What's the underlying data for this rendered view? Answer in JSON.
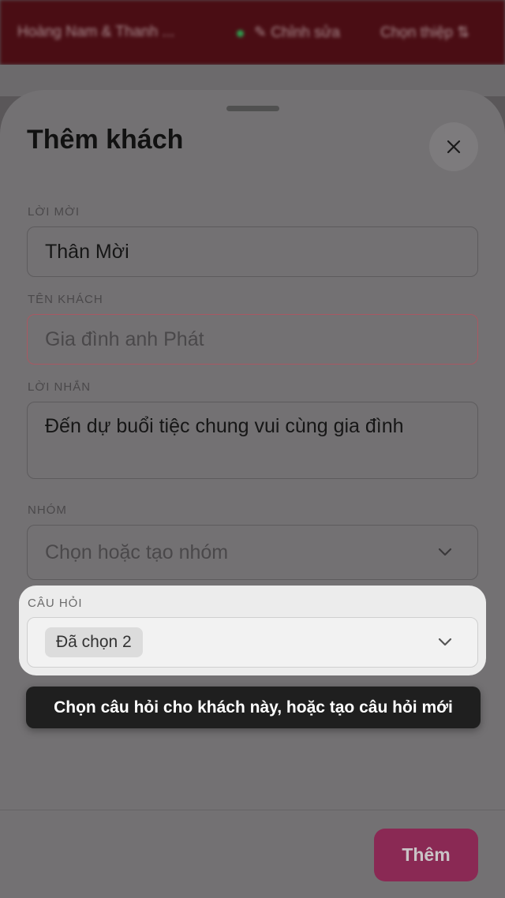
{
  "background": {
    "title": "Hoàng Nam & Thanh ...",
    "edit_label": "✎ Chỉnh sửa",
    "action_label": "Chọn thiệp ⇅"
  },
  "sheet": {
    "title": "Thêm khách",
    "close_icon": "close-icon",
    "invitation": {
      "label": "LỜI MỜI",
      "value": "Thân Mời"
    },
    "guest_name": {
      "label": "TÊN KHÁCH",
      "placeholder": "Gia đình anh Phát"
    },
    "message": {
      "label": "LỜI NHẮN",
      "value": "Đến dự buổi tiệc chung vui cùng gia đình"
    },
    "group": {
      "label": "NHÓM",
      "placeholder": "Chọn hoặc tạo nhóm"
    },
    "questions": {
      "label": "CÂU HỎI",
      "selected_chip": "Đã chọn 2"
    },
    "submit_label": "Thêm"
  },
  "tooltip": {
    "text": "Chọn câu hỏi cho khách này, hoặc tạo câu hỏi mới"
  },
  "colors": {
    "accent": "#c2185b",
    "tooltip_bg": "#1f1f1f",
    "header_bg": "#4a0d14"
  }
}
